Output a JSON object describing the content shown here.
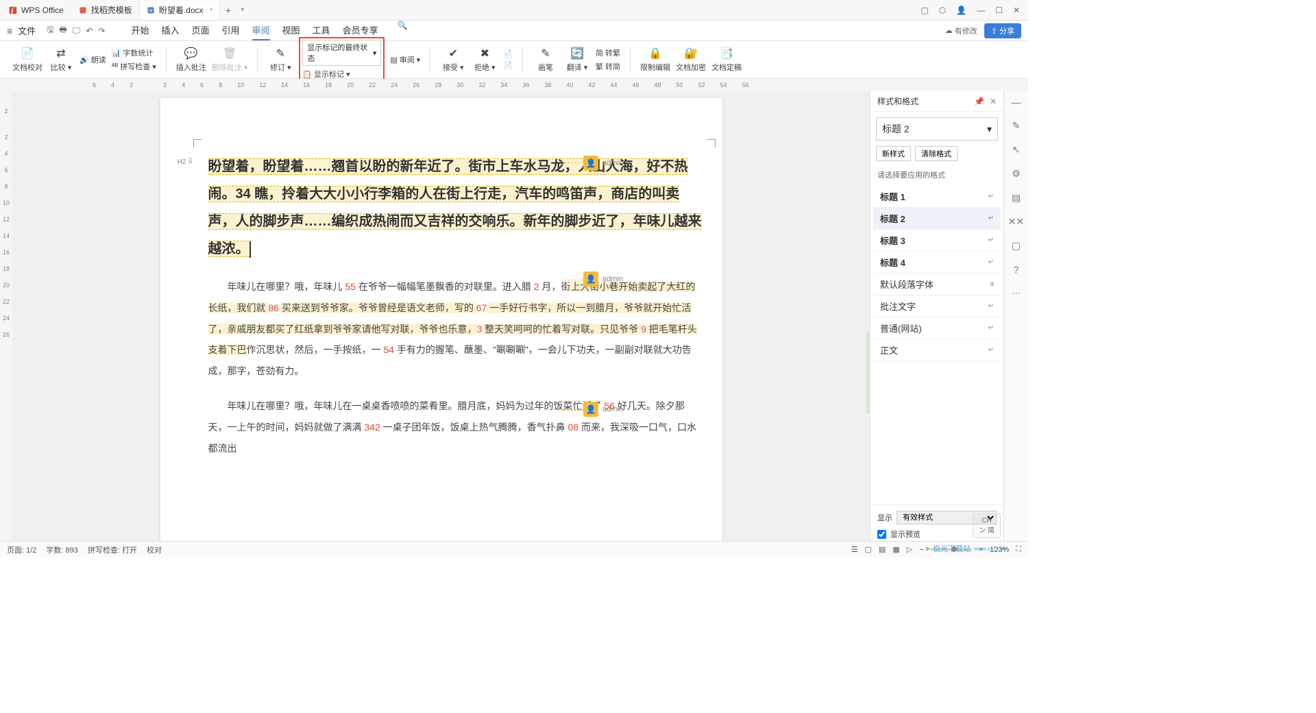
{
  "app": {
    "name": "WPS Office"
  },
  "tabs": {
    "t1": {
      "label": "找稻壳模板"
    },
    "t2": {
      "label": "盼望着.docx"
    }
  },
  "file_menu": "文件",
  "menus": {
    "start": "开始",
    "insert": "插入",
    "page": "页面",
    "ref": "引用",
    "review": "审阅",
    "view": "视图",
    "tool": "工具",
    "member": "会员专享"
  },
  "editing_badge": "有修改",
  "share": "分享",
  "ribbon": {
    "proofread": "文档校对",
    "compare": "比较",
    "read": "朗读",
    "wordcount": "字数统计",
    "spellcheck": "拼写检查",
    "insertcomment": "插入批注",
    "deletecomment": "删除批注",
    "revise": "修订",
    "revision_state_select": "显示标记的最终状态",
    "show_markup": "显示标记",
    "reviewpane": "审阅",
    "accept": "接受",
    "reject": "拒绝",
    "erase": "画笔",
    "translate": "翻译",
    "simp2trad": "转繁",
    "trad2simp": "转简",
    "restrict": "限制编辑",
    "encrypt": "文档加密",
    "finalize": "文档定稿"
  },
  "ruler": [
    "6",
    "4",
    "2",
    "",
    "2",
    "4",
    "6",
    "8",
    "10",
    "12",
    "14",
    "16",
    "18",
    "20",
    "22",
    "24",
    "26",
    "28",
    "30",
    "32",
    "34",
    "36",
    "38",
    "40",
    "42",
    "44",
    "46",
    "48",
    "50",
    "52",
    "54",
    "56"
  ],
  "vruler": [
    "",
    "2",
    "",
    "2",
    "4",
    "6",
    "8",
    "10",
    "12",
    "14",
    "16",
    "18",
    "20",
    "22",
    "24",
    "26"
  ],
  "outline_tag": "H2",
  "doc": {
    "para1": "盼望着，盼望着……翘首以盼的新年近了。街市上车水马龙，人山人海，好不热闹。34 瞧，拎着大大小小行李箱的人在街上行走，汽车的鸣笛声，商店的叫卖声，人的脚步声……编织成热闹而又吉祥的交响乐。新年的脚步近了，年味儿越来越浓。",
    "para2_a": "年味儿在哪里？哦，年味儿 ",
    "para2_b": " 在爷爷一幅幅笔墨飘香的对联里。进入腊 ",
    "para2_c": " 月，街",
    "para2_d": "上大街小巷开始卖起了大红的长纸，我们就 ",
    "para2_e": " 买来送到爷爷家。爷爷曾经是语文老师，写的 ",
    "para2_f": " 一手好行书字，所以一到腊月，爷爷就开始忙活了，亲戚朋友都买了红纸拿到爷爷家请他写对联，爷爷也乐意，",
    "para2_g": " 整天笑呵呵的忙着写对联。只见爷爷 ",
    "para2_h": " 把毛笔杆头支着下巴",
    "para2_i": "作沉思状，然后，一手按纸，一 ",
    "para2_j": " 手有力的握笔、蘸墨、\"唰唰唰\"，一会儿下功夫，一副副对联就大功告成，那字，苍劲有力。",
    "para3_a": "年味儿在哪里？哦，年味儿在一桌桌香喷喷的菜肴里。腊月底，妈妈为过年的饭菜忙活了 ",
    "para3_b": " 好几天。除夕那天，一上午的时间，妈妈就做了满满 ",
    "para3_c": " 一桌子团年饭，饭桌上热气腾腾，香气扑鼻 ",
    "para3_d": " 而来，我深吸一口气，口水都流出",
    "n55": "55",
    "n2": "2",
    "n86": "86",
    "n67": "67",
    "n3": "3",
    "n9": "9",
    "n54": "54",
    "n56": "56",
    "n342": "342",
    "n08": "08"
  },
  "comments": {
    "c1": "admin",
    "c2": "admin",
    "c3": "admin"
  },
  "panel": {
    "title": "样式和格式",
    "current": "标题 2",
    "new_style": "新样式",
    "clear_fmt": "清除格式",
    "prompt": "请选择要应用的格式",
    "items": {
      "h1": "标题 1",
      "h2": "标题 2",
      "h3": "标题 3",
      "h4": "标题 4",
      "default_font": "默认段落字体",
      "comment_text": "批注文字",
      "normal_web": "普通(网站)",
      "body": "正文"
    },
    "display_label": "显示",
    "display_value": "有效样式",
    "preview_label": "显示预览"
  },
  "status": {
    "page": "页面: 1/2",
    "words": "字数: 893",
    "spell": "拼写检查: 打开",
    "proof": "校对",
    "zoom": "123%"
  },
  "ime": {
    "lang": "CH",
    "method": "ン 简"
  },
  "watermark": "极光下载站",
  "watermark_url": "www.xz7.com"
}
